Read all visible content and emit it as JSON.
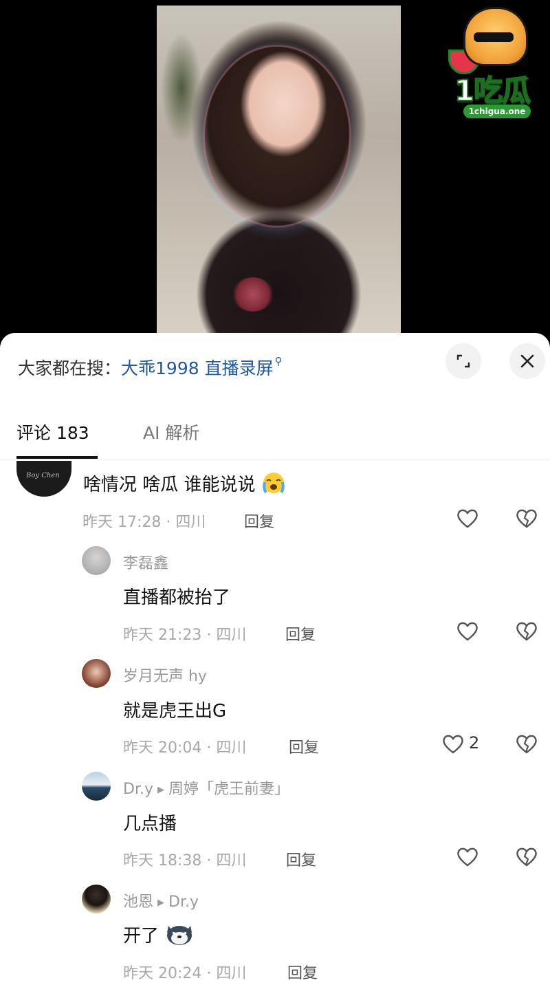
{
  "colors": {
    "link": "#1f58a8",
    "meta": "#a8a8a8",
    "text": "#111111"
  },
  "logo": {
    "brand": "1吃瓜",
    "url": "1chigua.one"
  },
  "search": {
    "prefix": "大家都在搜：",
    "query": "大乖1998 直播录屏"
  },
  "tabs": {
    "comments": "评论 183",
    "ai": "AI 解析"
  },
  "comments": [
    {
      "name": "",
      "text": "啥情况 啥瓜 谁能说说",
      "emoji": "crying-emoji",
      "meta": "昨天 17:28 · 四川",
      "reply": "回复",
      "likes": ""
    },
    {
      "name": "李磊鑫",
      "to": "",
      "text": "直播都被抬了",
      "meta": "昨天 21:23 · 四川",
      "reply": "回复",
      "likes": ""
    },
    {
      "name": "岁月无声 hy",
      "to": "",
      "text": "就是虎王出G",
      "meta": "昨天 20:04 · 四川",
      "reply": "回复",
      "likes": "2"
    },
    {
      "name": "Dr.y",
      "to": "周婷「虎王前妻」",
      "text": "几点播",
      "meta": "昨天 18:38 · 四川",
      "reply": "回复",
      "likes": ""
    },
    {
      "name": "池恩",
      "to": "Dr.y",
      "text": "开了",
      "emoji": "husky-emoji",
      "meta": "昨天 20:24 · 四川",
      "reply": "回复",
      "likes": ""
    }
  ]
}
